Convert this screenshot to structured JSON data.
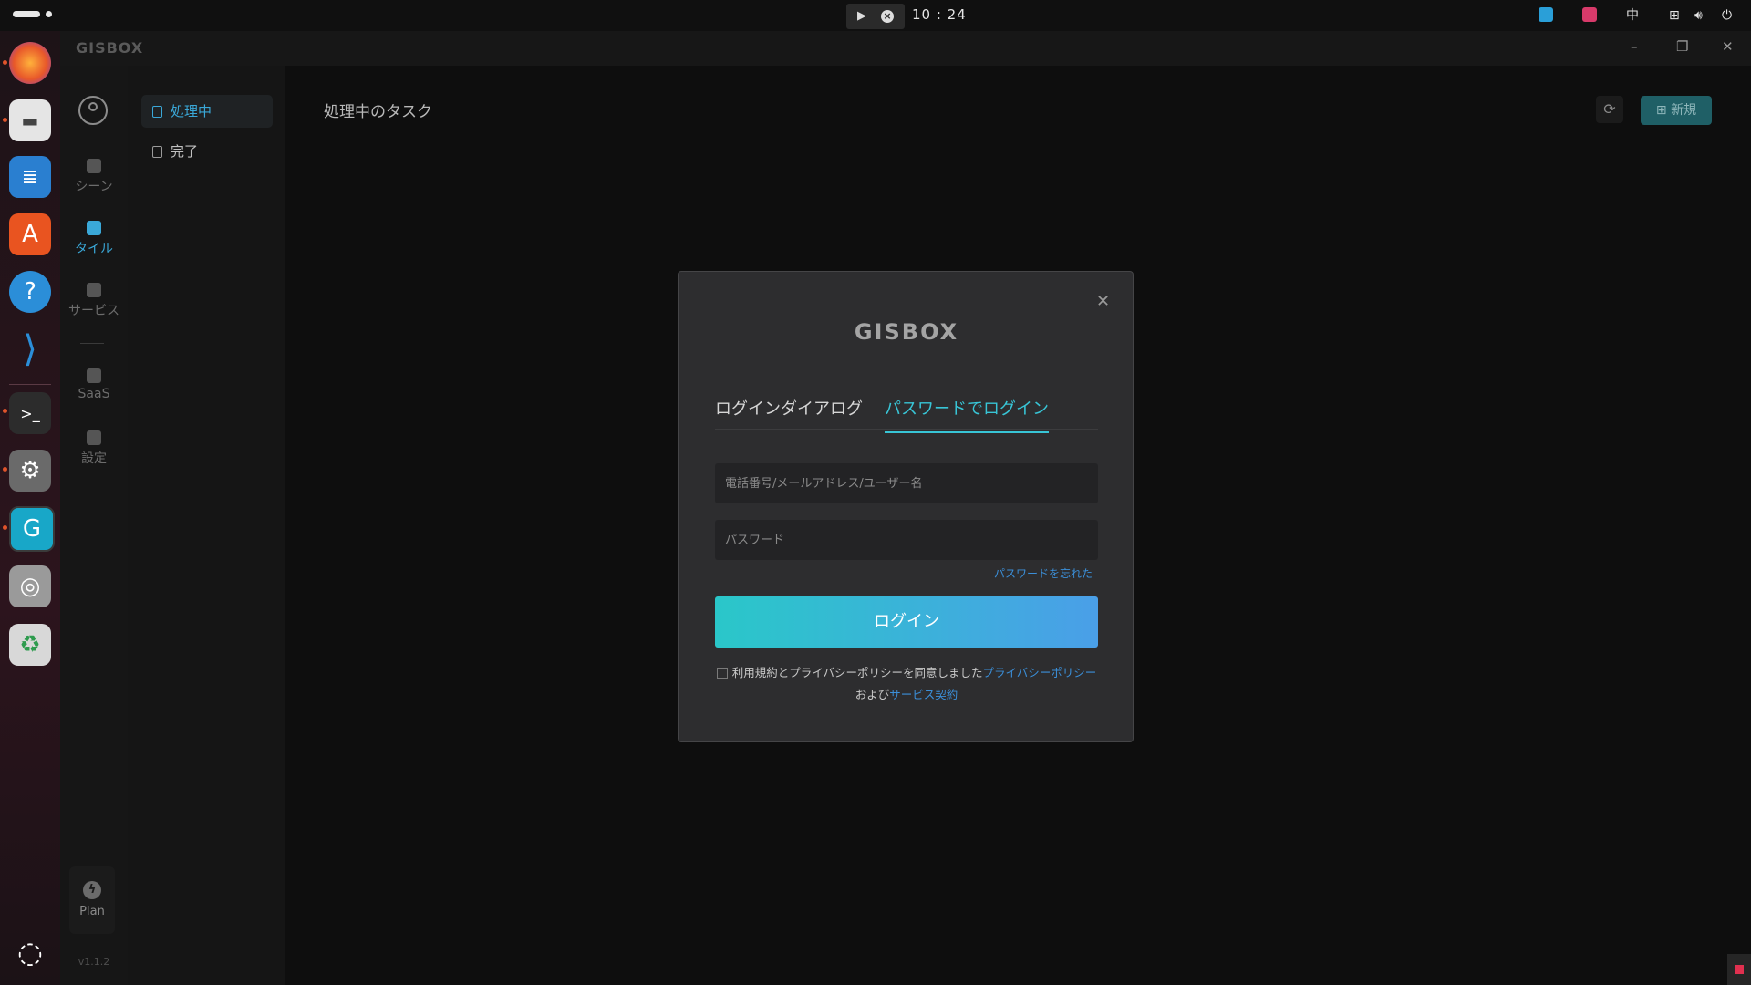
{
  "system": {
    "clock": "10 : 24",
    "ime": "中"
  },
  "app": {
    "title": "GISBOX",
    "version": "v1.1.2"
  },
  "nav": {
    "items": [
      {
        "label": "シーン"
      },
      {
        "label": "タイル"
      },
      {
        "label": "サービス"
      },
      {
        "label": "SaaS"
      },
      {
        "label": "設定"
      }
    ],
    "plan_label": "Plan"
  },
  "subnav": {
    "items": [
      {
        "label": "処理中"
      },
      {
        "label": "完了"
      }
    ]
  },
  "main": {
    "title": "処理中のタスク",
    "new_button": "新規"
  },
  "dialog": {
    "logo": "GISBOX",
    "tabs": [
      "ログインダイアログ",
      "パスワードでログイン"
    ],
    "active_tab": 1,
    "username_placeholder": "電話番号/メールアドレス/ユーザー名",
    "password_placeholder": "パスワード",
    "forgot_password": "パスワードを忘れた",
    "login_button": "ログイン",
    "agree_text": "利用規約とプライバシーポリシーを同意しました",
    "privacy_link": "プライバシーポリシー",
    "and_text": "および",
    "service_link": "サービス契約"
  },
  "colors": {
    "accent": "#38c5d6",
    "link": "#3b8fd9",
    "login_gradient_start": "#2ac7c9",
    "login_gradient_end": "#4a9fe8"
  }
}
